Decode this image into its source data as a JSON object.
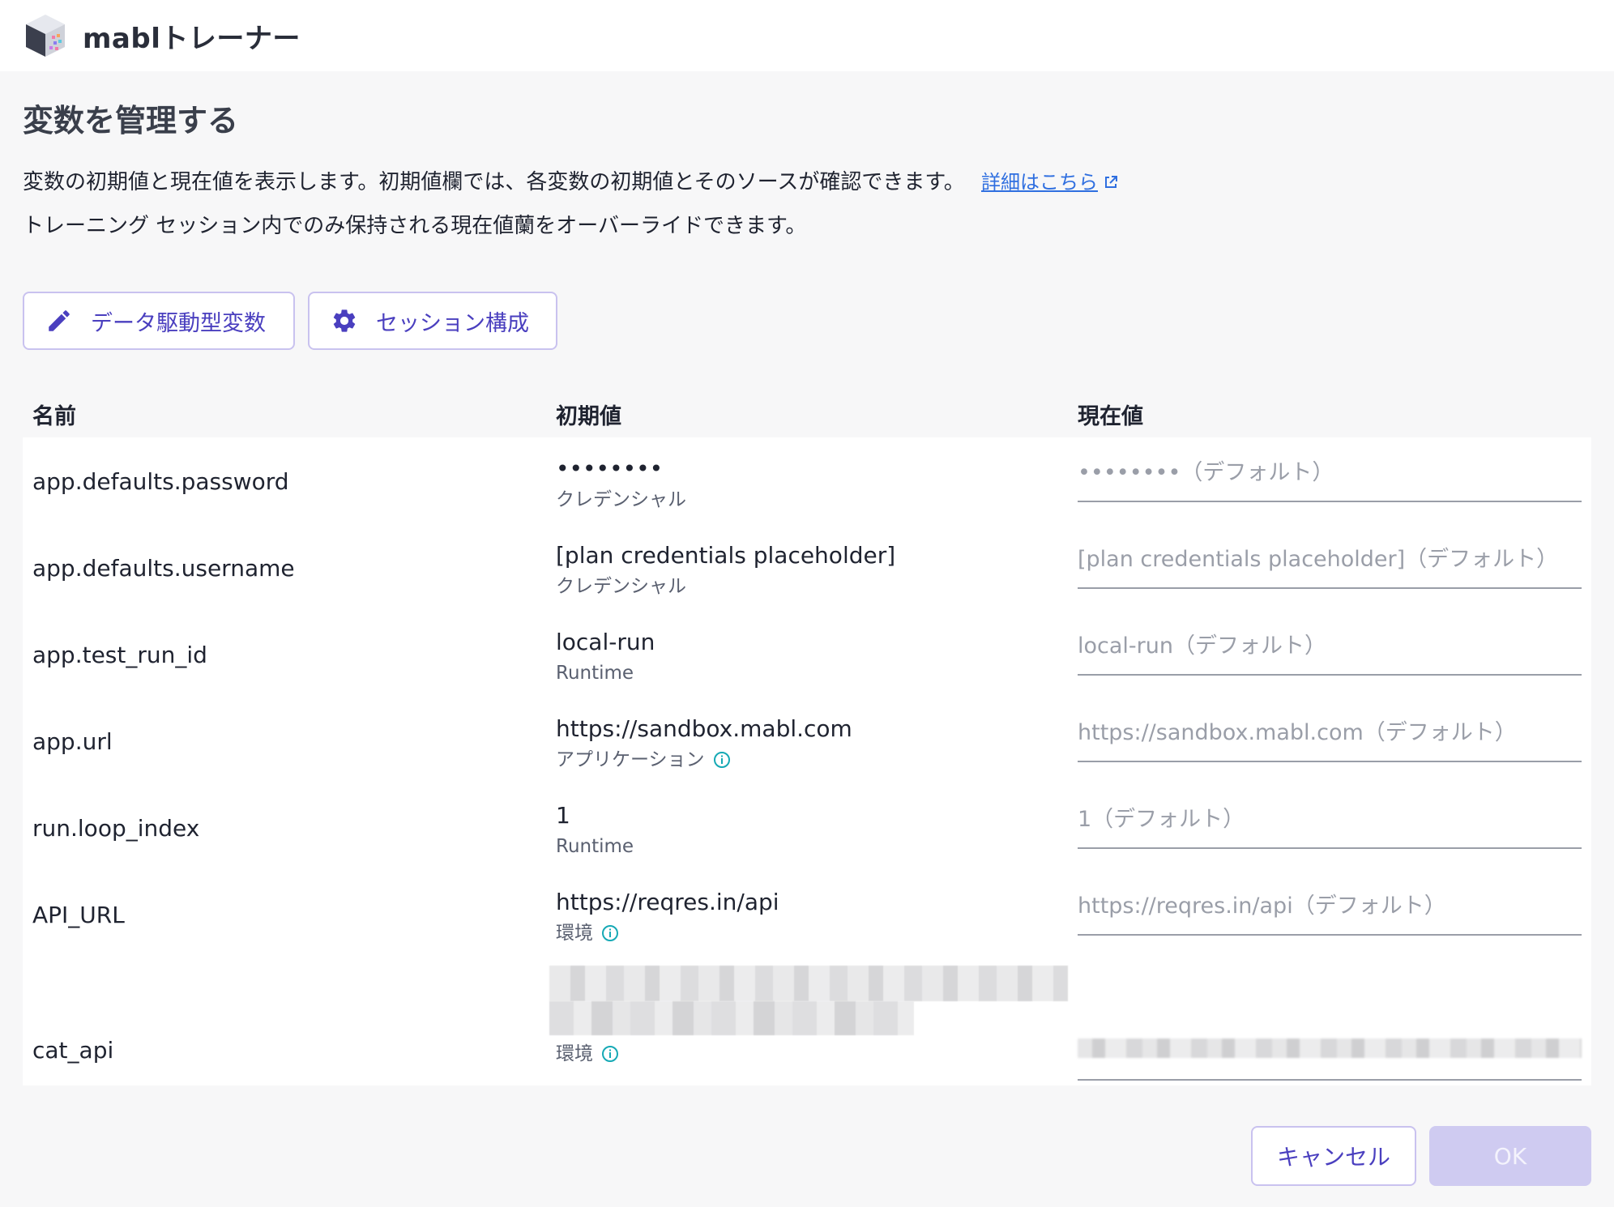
{
  "app": {
    "title": "mablトレーナー",
    "logo_icon": "mabl-logo-icon"
  },
  "dialog": {
    "title": "変数を管理する",
    "description_line1": "変数の初期値と現在値を表示します。初期値欄では、各変数の初期値とそのソースが確認できます。",
    "learn_more_label": "詳細はこちら",
    "description_line2": "トレーニング セッション内でのみ保持される現在値蘭をオーバーライドできます。"
  },
  "toolbar": {
    "data_driven_label": "データ駆動型変数",
    "data_driven_icon": "pencil-icon",
    "session_config_label": "セッション構成",
    "session_config_icon": "gear-icon"
  },
  "table": {
    "headers": {
      "name": "名前",
      "initial": "初期値",
      "current": "現在値"
    },
    "rows": [
      {
        "name": "app.defaults.password",
        "initial_value": "••••••••",
        "source": "クレデンシャル",
        "current_placeholder": "••••••••（デフォルト）",
        "info": false
      },
      {
        "name": "app.defaults.username",
        "initial_value": "[plan credentials placeholder]",
        "source": "クレデンシャル",
        "current_placeholder": "[plan credentials placeholder]（デフォルト）",
        "info": false
      },
      {
        "name": "app.test_run_id",
        "initial_value": "local-run",
        "source": "Runtime",
        "current_placeholder": "local-run（デフォルト）",
        "info": false
      },
      {
        "name": "app.url",
        "initial_value": "https://sandbox.mabl.com",
        "source": "アプリケーション",
        "current_placeholder": "https://sandbox.mabl.com（デフォルト）",
        "info": true
      },
      {
        "name": "run.loop_index",
        "initial_value": "1",
        "source": "Runtime",
        "current_placeholder": "1（デフォルト）",
        "info": false
      },
      {
        "name": "API_URL",
        "initial_value": "https://reqres.in/api",
        "source": "環境",
        "current_placeholder": "https://reqres.in/api（デフォルト）",
        "info": true
      },
      {
        "name": "cat_api",
        "initial_value": "",
        "source": "環境",
        "current_placeholder": "",
        "info": true,
        "value_redacted": true
      }
    ]
  },
  "footer": {
    "cancel_label": "キャンセル",
    "ok_label": "OK"
  },
  "colors": {
    "accent": "#4a3fbf",
    "link": "#2f6fe0",
    "info": "#16a9b5",
    "ok_disabled": "#cfcbf1"
  }
}
